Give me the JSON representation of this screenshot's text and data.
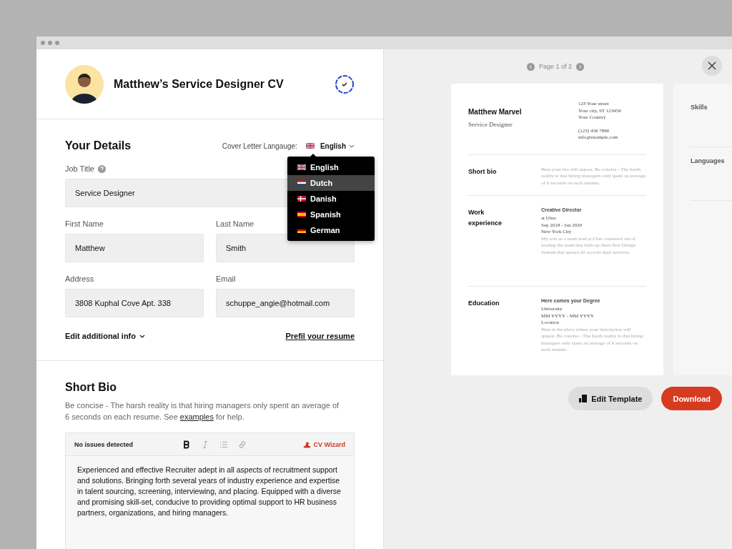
{
  "header": {
    "title": "Matthew’s Service Designer CV"
  },
  "details": {
    "heading": "Your Details",
    "language": {
      "label": "Cover Letter Langauge:",
      "value": "English",
      "kind": "uk"
    },
    "language_menu": [
      {
        "label": "English",
        "kind": "uk",
        "highlighted": false
      },
      {
        "label": "Dutch",
        "kind": "nl",
        "highlighted": true
      },
      {
        "label": "Danish",
        "kind": "dk",
        "highlighted": false
      },
      {
        "label": "Spanish",
        "kind": "es",
        "highlighted": false
      },
      {
        "label": "German",
        "kind": "de",
        "highlighted": false
      }
    ],
    "job_title": {
      "label": "Job Title",
      "value": "Service Designer"
    },
    "fields": [
      {
        "label": "First Name",
        "value": "Matthew"
      },
      {
        "label": "Last Name",
        "value": "Smith"
      },
      {
        "label": "Address",
        "value": "3808 Kuphal Cove Apt. 338"
      },
      {
        "label": "Email",
        "value": "schuppe_angie@hotmail.com"
      }
    ],
    "additional": "Edit additional info",
    "prefill": "Prefil your resume"
  },
  "short_bio": {
    "heading": "Short Bio",
    "hint": "Be concise - The harsh reality is that hiring managers only spent an average of 6 seconds on each resume. See ",
    "hint_link": "examples",
    "hint_end": " for help.",
    "status": "No issues detected",
    "tools": [
      {
        "kind": "bold",
        "active": true
      },
      {
        "kind": "italic",
        "active": false
      },
      {
        "kind": "list",
        "active": false
      },
      {
        "kind": "link",
        "active": false
      }
    ],
    "wizard": "CV Wizard",
    "text": "Experienced and effective Recruiter adept in all aspects of recruitment support and solutions. Bringing forth several years of industry experience and expertise in talent sourcing, screening, interviewing, and placing. Equipped with a diverse and promising skill-set, conducive to providing optimal support to HR business partners, organizations, and hiring managers."
  },
  "preview": {
    "pager": "Page 1 of 2",
    "name": "Matthew Marvel",
    "role": "Service Designer",
    "address": [
      "123 Your street",
      "Your city, ST 123456",
      "Your Country"
    ],
    "contact": [
      "(123) 456 7890",
      "info@example.com"
    ],
    "sections": [
      {
        "title": "Short bio",
        "kind": "text",
        "body": "Here your bio will appear. Be concise - The harsh reality is that hiring managers only spent an average of 6 seconds on each resume."
      },
      {
        "title": "Work experience",
        "kind": "entry",
        "entry_title": "Creative Director",
        "lines": [
          "at Uber",
          "Sep 2018 - Jan 2020",
          "New York City"
        ],
        "body": "My role as a team lead at Uber consisted out of leading the team that built up there first Design System that spread all accross their services."
      },
      {
        "title": "Education",
        "kind": "entry",
        "entry_title": "Here comes your Degree",
        "lines": [
          "University",
          "MM YYYY - MM YYYY",
          "Location"
        ],
        "body": "Here is the place where your description will appear. Be concise - The harsh reality is that hiring managers only spent an average of 6 seconds on each resume."
      }
    ],
    "page2_sections": [
      "Skills",
      "Languages"
    ],
    "edit_button": "Edit Template",
    "download_button": "Download"
  }
}
